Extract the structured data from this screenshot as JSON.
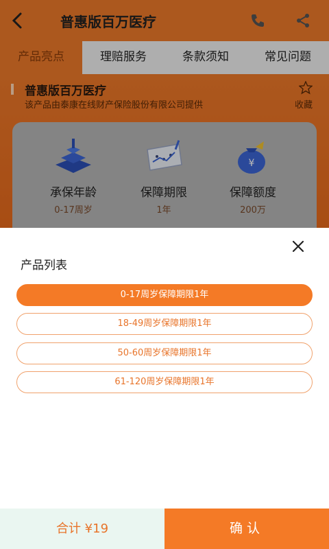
{
  "header": {
    "title": "普惠版百万医疗"
  },
  "tabs": [
    {
      "label": "产品亮点",
      "active": true
    },
    {
      "label": "理赔服务",
      "active": false
    },
    {
      "label": "条款须知",
      "active": false
    },
    {
      "label": "常见问题",
      "active": false
    }
  ],
  "product": {
    "name": "普惠版百万医疗",
    "provider": "该产品由泰康在线财产保险股份有限公司提供",
    "favorite_label": "收藏"
  },
  "features": [
    {
      "label": "承保年龄",
      "value": "0-17周岁",
      "icon": "stacked-cube-icon"
    },
    {
      "label": "保障期限",
      "value": "1年",
      "icon": "calendar-chart-icon"
    },
    {
      "label": "保障额度",
      "value": "200万",
      "icon": "money-bag-icon"
    }
  ],
  "sheet": {
    "title": "产品列表",
    "options": [
      {
        "label": "0-17周岁保障期限1年",
        "selected": true
      },
      {
        "label": "18-49周岁保障期限1年",
        "selected": false
      },
      {
        "label": "50-60周岁保障期限1年",
        "selected": false
      },
      {
        "label": "61-120周岁保障期限1年",
        "selected": false
      }
    ]
  },
  "footer": {
    "total": "合计 ¥19",
    "confirm": "确认"
  },
  "colors": {
    "accent": "#f47a26",
    "header": "#ef7a2a",
    "total_bg": "#eaf6f1"
  }
}
